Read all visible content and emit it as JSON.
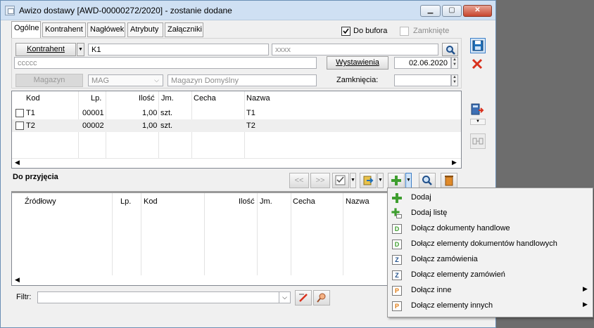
{
  "window": {
    "title": "Awizo dostawy [AWD-00000272/2020]  - zostanie dodane",
    "min": "▁",
    "max": "▢",
    "close": "✕"
  },
  "tabs": [
    {
      "label": "Ogólne"
    },
    {
      "label": "Kontrahent"
    },
    {
      "label": "Nagłówek"
    },
    {
      "label": "Atrybuty"
    },
    {
      "label": "Załączniki"
    }
  ],
  "flags": {
    "do_bufora": "Do bufora",
    "zamkniete": "Zamknięte"
  },
  "form": {
    "kontrahent_btn": "Kontrahent",
    "kontrahent_code": "K1",
    "kontrahent_extra": "xxxx",
    "address": "ccccc",
    "wystawienia_btn": "Wystawienia",
    "wystawienia_date": "02.06.2020",
    "magazyn_btn": "Magazyn",
    "magazyn_code": "MAG",
    "magazyn_name": "Magazyn Domyślny",
    "zamkniecia_label": "Zamknięcia:",
    "zamkniecia_date": ""
  },
  "top_grid": {
    "headers": {
      "kod": "Kod",
      "lp": "Lp.",
      "ilosc": "Ilość",
      "jm": "Jm.",
      "cecha": "Cecha",
      "nazwa": "Nazwa"
    },
    "rows": [
      {
        "kod": "T1",
        "lp": "00001",
        "ilosc": "1,00",
        "jm": "szt.",
        "cecha": "",
        "nazwa": "T1"
      },
      {
        "kod": "T2",
        "lp": "00002",
        "ilosc": "1,00",
        "jm": "szt.",
        "cecha": "",
        "nazwa": "T2"
      }
    ]
  },
  "section": {
    "title": "Do przyjęcia",
    "prev": "<<",
    "next": ">>"
  },
  "bottom_grid": {
    "headers": {
      "zrodlowy": "Źródłowy",
      "lp": "Lp.",
      "kod": "Kod",
      "ilosc": "Ilość",
      "jm": "Jm.",
      "cecha": "Cecha",
      "nazwa": "Nazwa"
    }
  },
  "filter": {
    "label": "Filtr:",
    "value": ""
  },
  "menu": {
    "items": [
      {
        "label": "Dodaj",
        "icon": "plus-icon",
        "submenu": false
      },
      {
        "label": "Dodaj listę",
        "icon": "add-list-icon",
        "submenu": false
      },
      {
        "label": "Dołącz dokumenty handlowe",
        "icon": "doc-d-icon",
        "submenu": false
      },
      {
        "label": "Dołącz elementy dokumentów handlowych",
        "icon": "doc-d-icon",
        "submenu": false
      },
      {
        "label": "Dołącz zamówienia",
        "icon": "doc-z-icon",
        "submenu": false
      },
      {
        "label": "Dołącz elementy zamówień",
        "icon": "doc-z-icon",
        "submenu": false
      },
      {
        "label": "Dołącz inne",
        "icon": "doc-p-icon",
        "submenu": true
      },
      {
        "label": "Dołącz elementy innych",
        "icon": "doc-p-icon",
        "submenu": true
      }
    ],
    "submenu_arrow": "▶",
    "letters": {
      "d": "D",
      "z": "Z",
      "p": "P"
    }
  },
  "colors": {
    "title_bg": "#cfe0f3",
    "accent_blue": "#1f6fb8",
    "green": "#3e9e2f",
    "red": "#d9311d",
    "row_alt": "#efefef"
  }
}
